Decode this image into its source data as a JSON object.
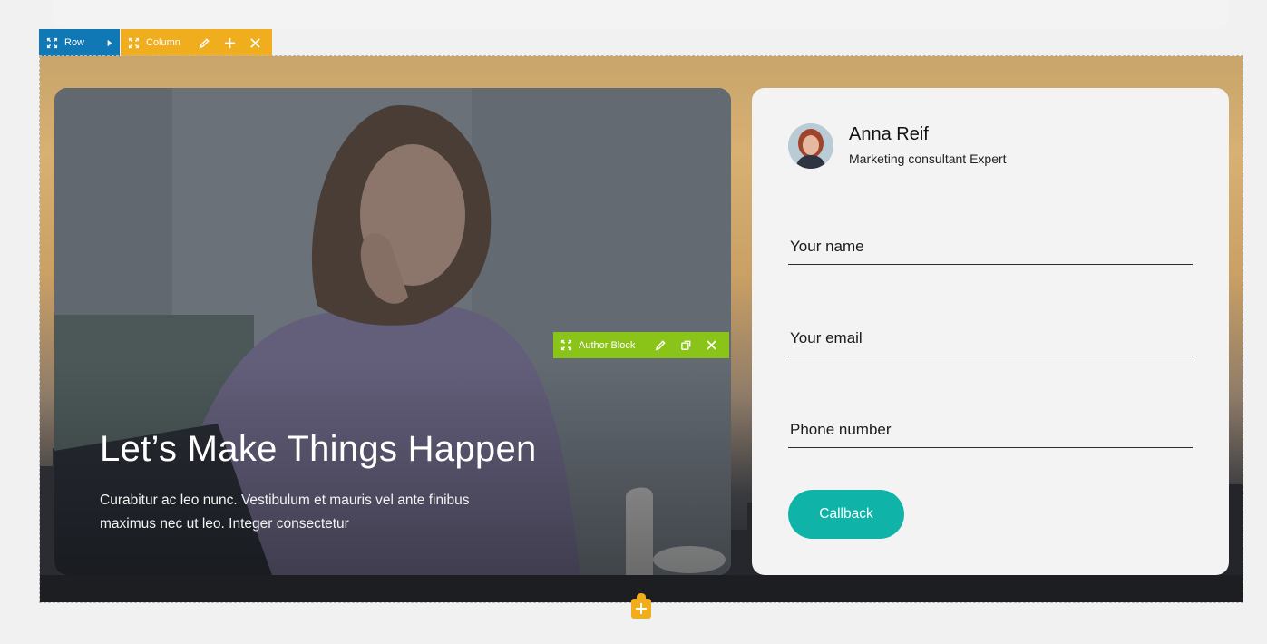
{
  "toolbar": {
    "row_label": "Row",
    "column_label": "Column",
    "author_block_label": "Author Block"
  },
  "hero": {
    "title": "Let’s Make Things Happen",
    "text": "Curabitur ac leo nunc. Vestibulum et mauris vel ante finibus maximus nec ut leo. Integer consectetur"
  },
  "author": {
    "name": "Anna Reif",
    "role": "Marketing consultant Expert"
  },
  "form": {
    "name_placeholder": "Your name",
    "email_placeholder": "Your email",
    "phone_placeholder": "Phone number",
    "button_label": "Callback"
  },
  "colors": {
    "row_toolbar": "#0f78b5",
    "column_toolbar": "#f0ad1e",
    "author_toolbar": "#8bc418",
    "button": "#0fb3a8"
  },
  "icons": [
    "move-icon",
    "caret-right-icon",
    "pencil-icon",
    "plus-icon",
    "close-icon",
    "duplicate-icon",
    "add-icon"
  ]
}
